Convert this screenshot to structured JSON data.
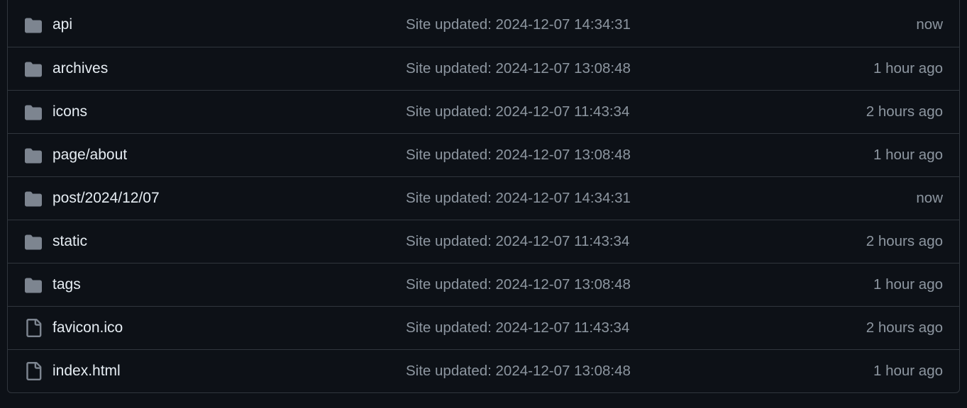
{
  "colors": {
    "background": "#0d1117",
    "border": "#30363d",
    "folder_icon": "#7d8590",
    "name_text": "#e6edf3",
    "muted_text": "#8d96a0"
  },
  "files": [
    {
      "name": "api",
      "type": "folder",
      "icon": "folder-icon",
      "commit": "Site updated: 2024-12-07 14:34:31",
      "age": "now"
    },
    {
      "name": "archives",
      "type": "folder",
      "icon": "folder-icon",
      "commit": "Site updated: 2024-12-07 13:08:48",
      "age": "1 hour ago"
    },
    {
      "name": "icons",
      "type": "folder",
      "icon": "folder-icon",
      "commit": "Site updated: 2024-12-07 11:43:34",
      "age": "2 hours ago"
    },
    {
      "name": "page/about",
      "type": "folder",
      "icon": "folder-icon",
      "commit": "Site updated: 2024-12-07 13:08:48",
      "age": "1 hour ago"
    },
    {
      "name": "post/2024/12/07",
      "type": "folder",
      "icon": "folder-icon",
      "commit": "Site updated: 2024-12-07 14:34:31",
      "age": "now"
    },
    {
      "name": "static",
      "type": "folder",
      "icon": "folder-icon",
      "commit": "Site updated: 2024-12-07 11:43:34",
      "age": "2 hours ago"
    },
    {
      "name": "tags",
      "type": "folder",
      "icon": "folder-icon",
      "commit": "Site updated: 2024-12-07 13:08:48",
      "age": "1 hour ago"
    },
    {
      "name": "favicon.ico",
      "type": "file",
      "icon": "file-icon",
      "commit": "Site updated: 2024-12-07 11:43:34",
      "age": "2 hours ago"
    },
    {
      "name": "index.html",
      "type": "file",
      "icon": "file-icon",
      "commit": "Site updated: 2024-12-07 13:08:48",
      "age": "1 hour ago"
    }
  ]
}
